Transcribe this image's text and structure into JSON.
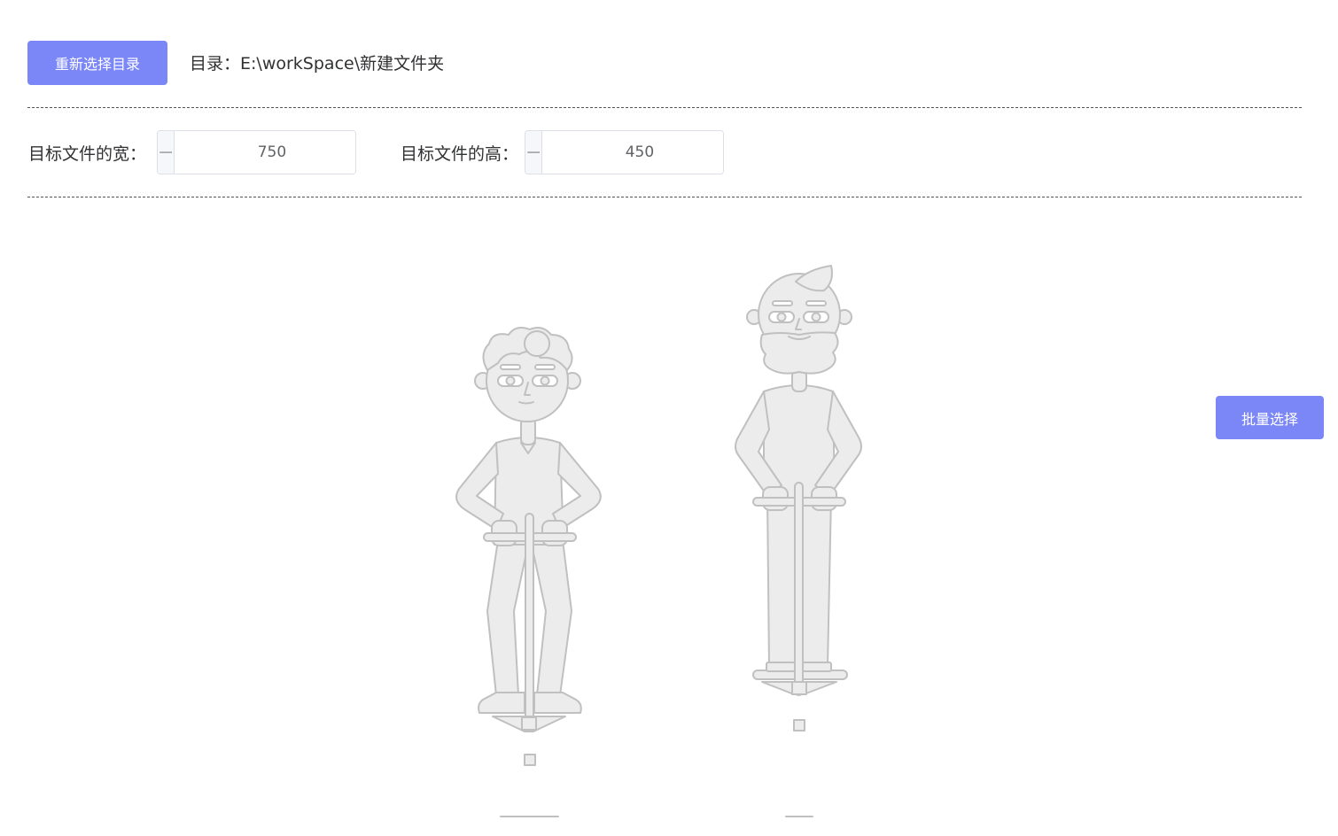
{
  "toolbar": {
    "reselect_label": "重新选择目录",
    "directory_prefix": "目录：",
    "directory_path": "E:\\workSpace\\新建文件夹"
  },
  "settings": {
    "width_label": "目标文件的宽：",
    "width_value": "750",
    "height_label": "目标文件的高：",
    "height_value": "450",
    "minus_symbol": "−",
    "plus_symbol": "+"
  },
  "actions": {
    "batch_label": "批量选择"
  },
  "illustration": {
    "icon": "empty-state-pogo-stick-illustration",
    "stroke_color": "#c0c0c0",
    "fill_color": "#ececec"
  },
  "colors": {
    "accent": "#7b87f7"
  }
}
